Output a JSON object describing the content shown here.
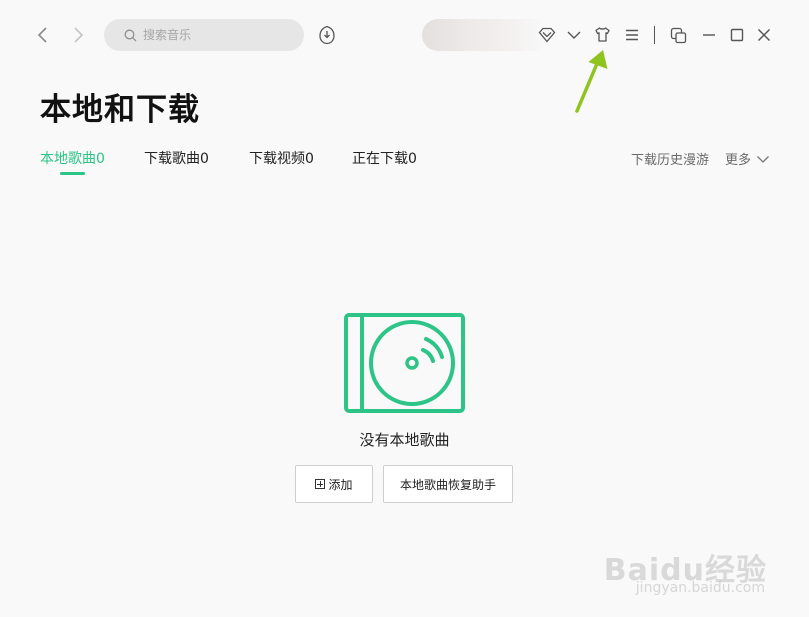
{
  "topbar": {
    "search_placeholder": "搜索音乐"
  },
  "page": {
    "title": "本地和下载"
  },
  "tabs": [
    {
      "label": "本地歌曲0",
      "active": true
    },
    {
      "label": "下载歌曲0",
      "active": false
    },
    {
      "label": "下载视频0",
      "active": false
    },
    {
      "label": "正在下载0",
      "active": false
    }
  ],
  "tab_actions": {
    "history": "下载历史漫游",
    "more": "更多"
  },
  "empty_state": {
    "message": "没有本地歌曲",
    "add_button": "添加",
    "restore_button": "本地歌曲恢复助手"
  },
  "watermark": {
    "logo": "Baidu经验",
    "url": "jingyan.baidu.com"
  },
  "colors": {
    "accent": "#2dc487",
    "annotation_arrow": "#8fc31f"
  }
}
